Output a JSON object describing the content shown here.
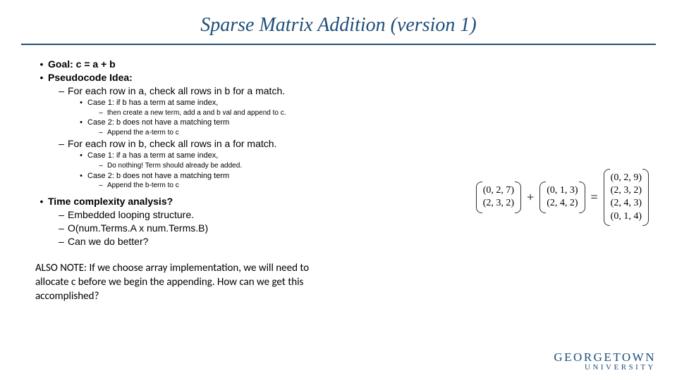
{
  "title": "Sparse Matrix Addition (version 1)",
  "bullets": {
    "goal": "Goal: c = a + b",
    "pseudo": "Pseudocode Idea:",
    "loop_a": "For each row in a, check all rows in b for a match.",
    "a_case1": "Case 1: if b has a term at same index,",
    "a_case1_sub": "then create a new term, add a and b val and append to c.",
    "a_case2": "Case 2: b does not have a matching term",
    "a_case2_sub": "Append the a-term to c",
    "loop_b": "For each row in b, check all rows in a for match.",
    "b_case1": "Case 1: if a has a term at same index,",
    "b_case1_sub": "Do nothing! Term should already be added.",
    "b_case2": "Case 2: b does not have a matching term",
    "b_case2_sub": "Append the b-term to c",
    "tc": "Time complexity analysis?",
    "tc1": "Embedded looping structure.",
    "tc2": "O(num.Terms.A x num.Terms.B)",
    "tc3": "Can we do better?"
  },
  "note": "ALSO NOTE: If we choose array implementation, we will need to allocate c before we begin the appending. How can we get this accomplished?",
  "matrices": {
    "a": [
      "(0,  2,  7)",
      "(2,  3,  2)"
    ],
    "b": [
      "(0,  1,  3)",
      "(2,  4,  2)"
    ],
    "c": [
      "(0,  2,  9)",
      "(2,  3,  2)",
      "(2,  4,  3)",
      "(0,  1,  4)"
    ],
    "plus": "+",
    "eq": "="
  },
  "logo": {
    "line1": "GEORGETOWN",
    "line2": "UNIVERSITY"
  }
}
